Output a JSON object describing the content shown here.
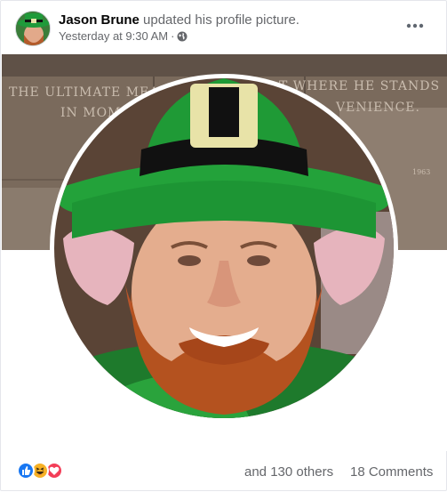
{
  "post": {
    "author": "Jason Brune",
    "action": "updated his profile picture.",
    "timestamp": "Yesterday at 9:30 AM",
    "separator": "·",
    "privacy_icon": "globe-icon",
    "more_icon": "more-options-icon"
  },
  "cover_photo": {
    "inscription_line1_left": "THE ULTIMATE MEAS",
    "inscription_line1_right": "T WHERE HE STANDS",
    "inscription_line2_left": "IN MOM",
    "inscription_line2_right": "VENIENCE.",
    "plaque_year": "1963"
  },
  "reactions": {
    "icons": [
      "like-icon",
      "haha-icon",
      "love-icon"
    ],
    "colors": {
      "like": "#1877f2",
      "haha": "#f7b125",
      "love": "#f33e58"
    },
    "others_text": "and 130 others",
    "comments_text": "18 Comments"
  }
}
